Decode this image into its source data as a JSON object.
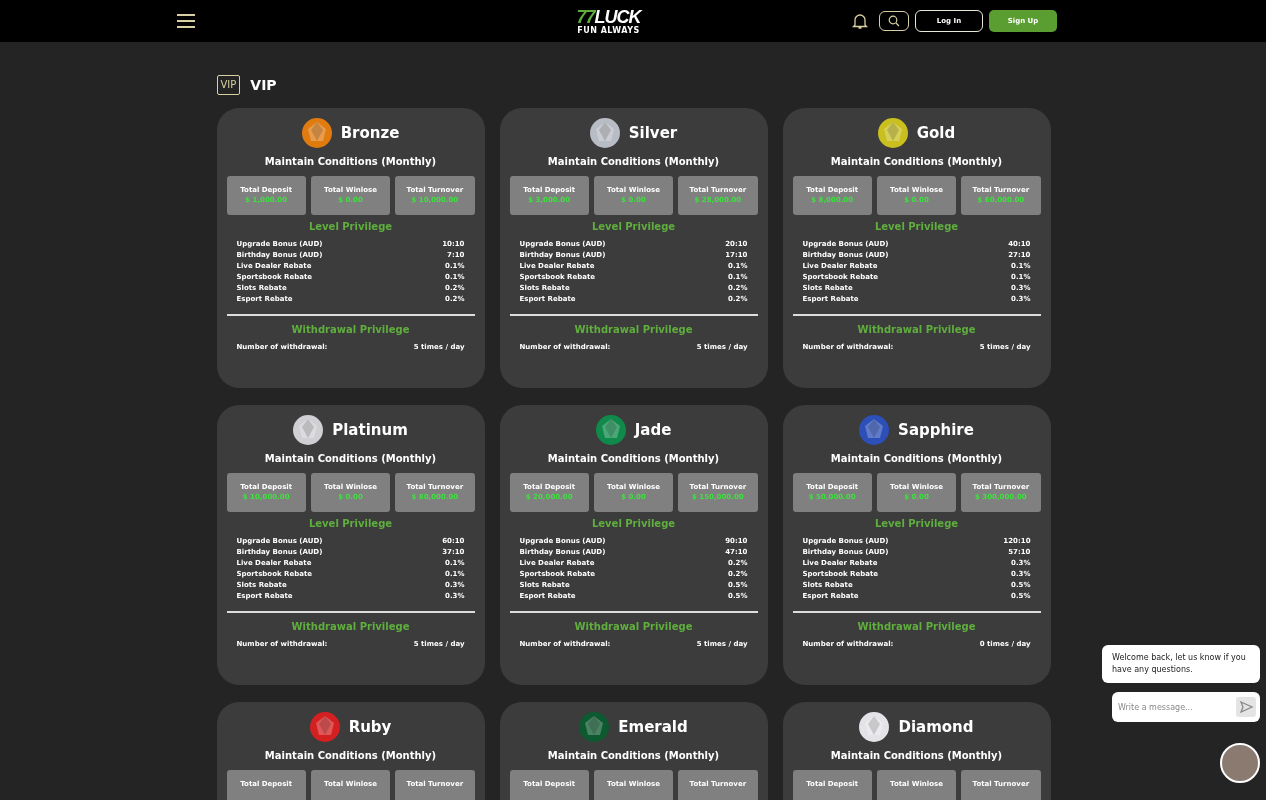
{
  "header": {
    "logo": {
      "accent": "77",
      "text": "LUCK",
      "tagline": "FUN ALWAYS"
    },
    "login": "Log In",
    "signup": "Sign Up"
  },
  "page": {
    "badge": "VIP",
    "title": "VIP"
  },
  "tiers": [
    {
      "name": "Bronze",
      "color": "#e07b10",
      "subtitle": "Maintain Conditions (Monthly)",
      "stats": [
        {
          "label": "Total Deposit",
          "amount": "$ 1,000.00"
        },
        {
          "label": "Total Winlose",
          "amount": "$ 0.00"
        },
        {
          "label": "Total Turnover",
          "amount": "$ 10,000.00"
        }
      ],
      "level_title": "Level Privilege",
      "privileges": [
        {
          "label": "Upgrade Bonus (AUD)",
          "value": "10:10"
        },
        {
          "label": "Birthday Bonus (AUD)",
          "value": "7:10"
        },
        {
          "label": "Live Dealer Rebate",
          "value": "0.1%"
        },
        {
          "label": "Sportsbook Rebate",
          "value": "0.1%"
        },
        {
          "label": "Slots Rebate",
          "value": "0.2%"
        },
        {
          "label": "Esport Rebate",
          "value": "0.2%"
        }
      ],
      "withdrawal_title": "Withdrawal Privilege",
      "withdrawal": {
        "label": "Number of withdrawal:",
        "value": "5 times / day"
      }
    },
    {
      "name": "Silver",
      "color": "#b8bcc4",
      "subtitle": "Maintain Conditions (Monthly)",
      "stats": [
        {
          "label": "Total Deposit",
          "amount": "$ 3,000.00"
        },
        {
          "label": "Total Winlose",
          "amount": "$ 0.00"
        },
        {
          "label": "Total Turnover",
          "amount": "$ 28,000.00"
        }
      ],
      "level_title": "Level Privilege",
      "privileges": [
        {
          "label": "Upgrade Bonus (AUD)",
          "value": "20:10"
        },
        {
          "label": "Birthday Bonus (AUD)",
          "value": "17:10"
        },
        {
          "label": "Live Dealer Rebate",
          "value": "0.1%"
        },
        {
          "label": "Sportsbook Rebate",
          "value": "0.1%"
        },
        {
          "label": "Slots Rebate",
          "value": "0.2%"
        },
        {
          "label": "Esport Rebate",
          "value": "0.2%"
        }
      ],
      "withdrawal_title": "Withdrawal Privilege",
      "withdrawal": {
        "label": "Number of withdrawal:",
        "value": "5 times / day"
      }
    },
    {
      "name": "Gold",
      "color": "#c9c020",
      "subtitle": "Maintain Conditions (Monthly)",
      "stats": [
        {
          "label": "Total Deposit",
          "amount": "$ 8,000.00"
        },
        {
          "label": "Total Winlose",
          "amount": "$ 0.00"
        },
        {
          "label": "Total Turnover",
          "amount": "$ 60,000.00"
        }
      ],
      "level_title": "Level Privilege",
      "privileges": [
        {
          "label": "Upgrade Bonus (AUD)",
          "value": "40:10"
        },
        {
          "label": "Birthday Bonus (AUD)",
          "value": "27:10"
        },
        {
          "label": "Live Dealer Rebate",
          "value": "0.1%"
        },
        {
          "label": "Sportsbook Rebate",
          "value": "0.1%"
        },
        {
          "label": "Slots Rebate",
          "value": "0.3%"
        },
        {
          "label": "Esport Rebate",
          "value": "0.3%"
        }
      ],
      "withdrawal_title": "Withdrawal Privilege",
      "withdrawal": {
        "label": "Number of withdrawal:",
        "value": "5 times / day"
      }
    },
    {
      "name": "Platinum",
      "color": "#d0d0d4",
      "subtitle": "Maintain Conditions (Monthly)",
      "stats": [
        {
          "label": "Total Deposit",
          "amount": "$ 10,000.00"
        },
        {
          "label": "Total Winlose",
          "amount": "$ 0.00"
        },
        {
          "label": "Total Turnover",
          "amount": "$ 80,000.00"
        }
      ],
      "level_title": "Level Privilege",
      "privileges": [
        {
          "label": "Upgrade Bonus (AUD)",
          "value": "60:10"
        },
        {
          "label": "Birthday Bonus (AUD)",
          "value": "37:10"
        },
        {
          "label": "Live Dealer Rebate",
          "value": "0.1%"
        },
        {
          "label": "Sportsbook Rebate",
          "value": "0.1%"
        },
        {
          "label": "Slots Rebate",
          "value": "0.3%"
        },
        {
          "label": "Esport Rebate",
          "value": "0.3%"
        }
      ],
      "withdrawal_title": "Withdrawal Privilege",
      "withdrawal": {
        "label": "Number of withdrawal:",
        "value": "5 times / day"
      }
    },
    {
      "name": "Jade",
      "color": "#0f8a4a",
      "subtitle": "Maintain Conditions (Monthly)",
      "stats": [
        {
          "label": "Total Deposit",
          "amount": "$ 20,000.00"
        },
        {
          "label": "Total Winlose",
          "amount": "$ 0.00"
        },
        {
          "label": "Total Turnover",
          "amount": "$ 150,000.00"
        }
      ],
      "level_title": "Level Privilege",
      "privileges": [
        {
          "label": "Upgrade Bonus (AUD)",
          "value": "90:10"
        },
        {
          "label": "Birthday Bonus (AUD)",
          "value": "47:10"
        },
        {
          "label": "Live Dealer Rebate",
          "value": "0.2%"
        },
        {
          "label": "Sportsbook Rebate",
          "value": "0.2%"
        },
        {
          "label": "Slots Rebate",
          "value": "0.5%"
        },
        {
          "label": "Esport Rebate",
          "value": "0.5%"
        }
      ],
      "withdrawal_title": "Withdrawal Privilege",
      "withdrawal": {
        "label": "Number of withdrawal:",
        "value": "5 times / day"
      }
    },
    {
      "name": "Sapphire",
      "color": "#2c4fb8",
      "subtitle": "Maintain Conditions (Monthly)",
      "stats": [
        {
          "label": "Total Deposit",
          "amount": "$ 50,000.00"
        },
        {
          "label": "Total Winlose",
          "amount": "$ 0.00"
        },
        {
          "label": "Total Turnover",
          "amount": "$ 300,000.00"
        }
      ],
      "level_title": "Level Privilege",
      "privileges": [
        {
          "label": "Upgrade Bonus (AUD)",
          "value": "120:10"
        },
        {
          "label": "Birthday Bonus (AUD)",
          "value": "57:10"
        },
        {
          "label": "Live Dealer Rebate",
          "value": "0.3%"
        },
        {
          "label": "Sportsbook Rebate",
          "value": "0.3%"
        },
        {
          "label": "Slots Rebate",
          "value": "0.5%"
        },
        {
          "label": "Esport Rebate",
          "value": "0.5%"
        }
      ],
      "withdrawal_title": "Withdrawal Privilege",
      "withdrawal": {
        "label": "Number of withdrawal:",
        "value": "0 times / day"
      }
    },
    {
      "name": "Ruby",
      "color": "#d42020",
      "subtitle": "Maintain Conditions (Monthly)",
      "stats": [
        {
          "label": "Total Deposit"
        },
        {
          "label": "Total Winlose"
        },
        {
          "label": "Total Turnover"
        }
      ]
    },
    {
      "name": "Emerald",
      "color": "#0e5a30",
      "subtitle": "Maintain Conditions (Monthly)",
      "stats": [
        {
          "label": "Total Deposit"
        },
        {
          "label": "Total Winlose"
        },
        {
          "label": "Total Turnover"
        }
      ]
    },
    {
      "name": "Diamond",
      "color": "#e4e4e8",
      "subtitle": "Maintain Conditions (Monthly)",
      "stats": [
        {
          "label": "Total Deposit"
        },
        {
          "label": "Total Winlose"
        },
        {
          "label": "Total Turnover"
        }
      ]
    }
  ],
  "chat": {
    "message": "Welcome back, let us know if you have any questions.",
    "placeholder": "Write a message..."
  }
}
